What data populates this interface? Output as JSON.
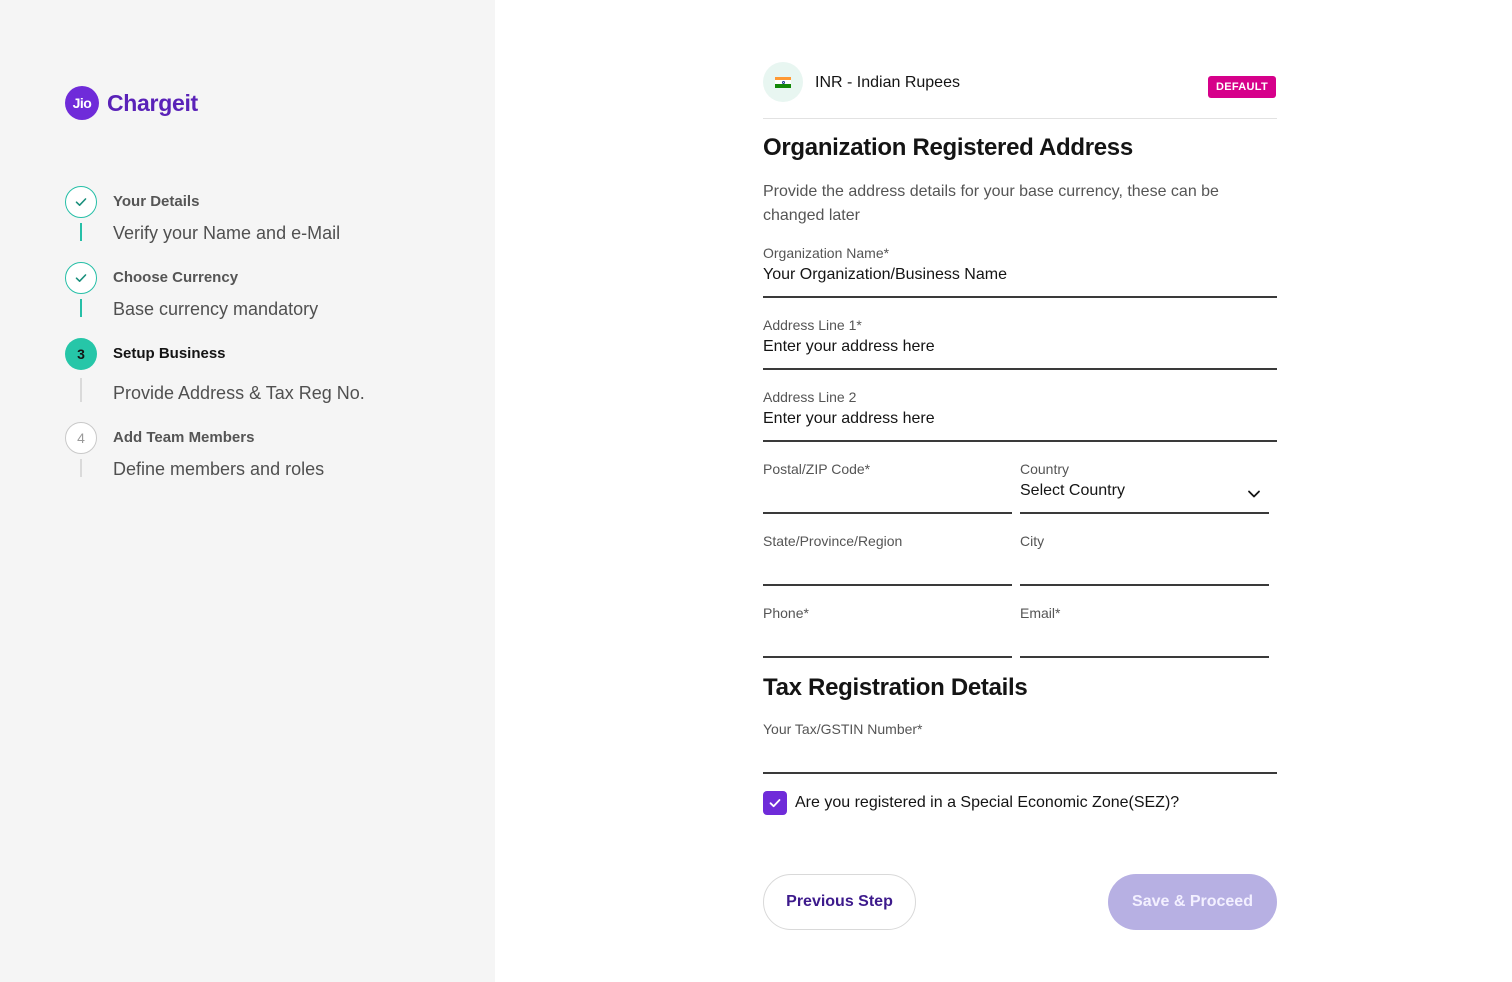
{
  "brand": {
    "badge": "Jio",
    "name": "Chargeit"
  },
  "steps": [
    {
      "title": "Your Details",
      "subtitle": "Verify your Name and e-Mail",
      "status": "done"
    },
    {
      "title": "Choose Currency",
      "subtitle": "Base currency mandatory",
      "status": "done"
    },
    {
      "number": "3",
      "title": "Setup Business",
      "subtitle": "Provide Address & Tax Reg No.",
      "status": "active"
    },
    {
      "number": "4",
      "title": "Add Team Members",
      "subtitle": "Define members and roles",
      "status": "pending"
    }
  ],
  "currency": {
    "name": "INR - Indian Rupees",
    "badge": "DEFAULT",
    "flag_icon": "india-flag-icon"
  },
  "address_section": {
    "title": "Organization Registered Address",
    "description": "Provide the address details for your base currency, these can be changed later",
    "fields": {
      "org_name": {
        "label": "Organization Name*",
        "value": "Your Organization/Business Name"
      },
      "address1": {
        "label": "Address Line 1*",
        "value": "Enter your address here"
      },
      "address2": {
        "label": "Address Line 2",
        "value": "Enter your address here"
      },
      "postal": {
        "label": "Postal/ZIP Code*",
        "value": ""
      },
      "country": {
        "label": "Country",
        "value": "Select Country"
      },
      "state": {
        "label": "State/Province/Region",
        "value": ""
      },
      "city": {
        "label": "City",
        "value": ""
      },
      "phone": {
        "label": "Phone*",
        "value": ""
      },
      "email": {
        "label": "Email*",
        "value": ""
      }
    }
  },
  "tax_section": {
    "title": "Tax Registration Details",
    "fields": {
      "gstin": {
        "label": "Your Tax/GSTIN Number*",
        "value": ""
      }
    },
    "sez": {
      "label": "Are you registered in a Special Economic Zone(SEZ)?",
      "checked": true
    }
  },
  "actions": {
    "previous": "Previous Step",
    "save": "Save & Proceed"
  },
  "colors": {
    "brand_purple": "#6f2bd9",
    "step_teal": "#26c6a8",
    "default_badge": "#d6008a",
    "save_disabled": "#b7b0e3"
  }
}
